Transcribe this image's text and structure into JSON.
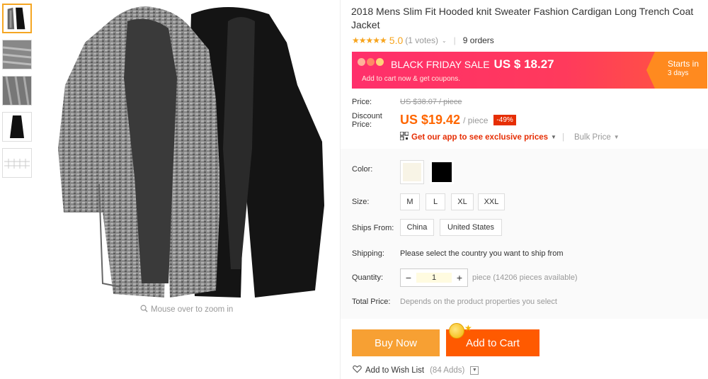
{
  "gallery": {
    "thumbnails": [
      "thumb-two-cardigans",
      "thumb-grey-knit-closeup",
      "thumb-grey-knit-detail",
      "thumb-black-cardigan",
      "thumb-size-chart"
    ],
    "zoom_hint": "Mouse over to zoom in"
  },
  "product": {
    "title": "2018 Mens Slim Fit Hooded knit Sweater Fashion Cardigan Long Trench Coat Jacket",
    "rating": "5.0",
    "votes": "(1 votes)",
    "orders": "9 orders"
  },
  "banner": {
    "headline": "BLACK FRIDAY SALE",
    "price": "US $ 18.27",
    "sub": "Add to cart now & get coupons.",
    "starts_label": "Starts in",
    "starts_value": "3 days"
  },
  "pricing": {
    "price_label": "Price:",
    "old_price": "US $38.07 / piece",
    "discount_label": "Discount Price:",
    "discount_price": "US $19.42",
    "unit": "/ piece",
    "discount_badge": "-49%",
    "app_link": "Get our app to see exclusive prices",
    "bulk_price": "Bulk Price"
  },
  "options": {
    "color_label": "Color:",
    "colors": [
      "#f8f4e6",
      "#000000"
    ],
    "size_label": "Size:",
    "sizes": [
      "M",
      "L",
      "XL",
      "XXL"
    ],
    "ships_from_label": "Ships From:",
    "ships_from": [
      "China",
      "United States"
    ],
    "shipping_label": "Shipping:",
    "shipping_text": "Please select the country you want to ship from",
    "quantity_label": "Quantity:",
    "quantity": "1",
    "quantity_note": "piece (14206 pieces available)",
    "total_label": "Total Price:",
    "total_text": "Depends on the product properties you select"
  },
  "actions": {
    "buy_now": "Buy Now",
    "add_to_cart": "Add to Cart",
    "wishlist": "Add to Wish List",
    "wishlist_count": "(84 Adds)"
  }
}
